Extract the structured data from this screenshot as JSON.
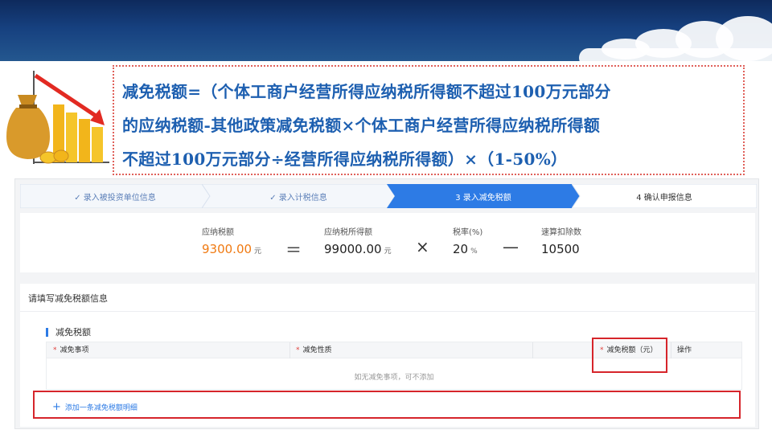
{
  "formula": {
    "lines": [
      "减免税额=（个体工商户经营所得应纳税所得额不超过100万元部分",
      "的应纳税额-其他政策减免税额×个体工商户经营所得应纳税所得额",
      "不超过100万元部分÷经营所得应纳税所得额）×（1-50%）"
    ]
  },
  "steps": [
    {
      "label": "✓ 录入被投资单位信息",
      "state": "done"
    },
    {
      "label": "✓ 录入计税信息",
      "state": "done"
    },
    {
      "label": "3 录入减免税额",
      "state": "active"
    },
    {
      "label": "4 确认申报信息",
      "state": "pending"
    }
  ],
  "calc": {
    "tax_payable": {
      "label": "应纳税额",
      "value": "9300.00",
      "unit": "元"
    },
    "equals": "＝",
    "taxable_income": {
      "label": "应纳税所得额",
      "value": "99000.00",
      "unit": "元"
    },
    "times": "×",
    "rate": {
      "label": "税率(%)",
      "value": "20",
      "unit": "%"
    },
    "minus": "—",
    "quick_deduction": {
      "label": "速算扣除数",
      "value": "10500"
    }
  },
  "form": {
    "title": "请填写减免税额信息",
    "section_title": "减免税额",
    "columns": [
      {
        "label": "减免事项",
        "required": "*"
      },
      {
        "label": "减免性质",
        "required": "*"
      },
      {
        "label": "",
        "required": ""
      },
      {
        "label": "减免税额（元）",
        "required": "*"
      },
      {
        "label": "操作",
        "required": ""
      }
    ],
    "empty_text": "如无减免事项，可不添加",
    "add_row": {
      "icon": "plus-icon",
      "label": "添加一条减免税额明细"
    }
  },
  "colors": {
    "header": "#16407f",
    "formula_text": "#1d5fb0",
    "active_step": "#2d7be5",
    "highlight": "#d6252b",
    "orange_value": "#f07a12"
  }
}
